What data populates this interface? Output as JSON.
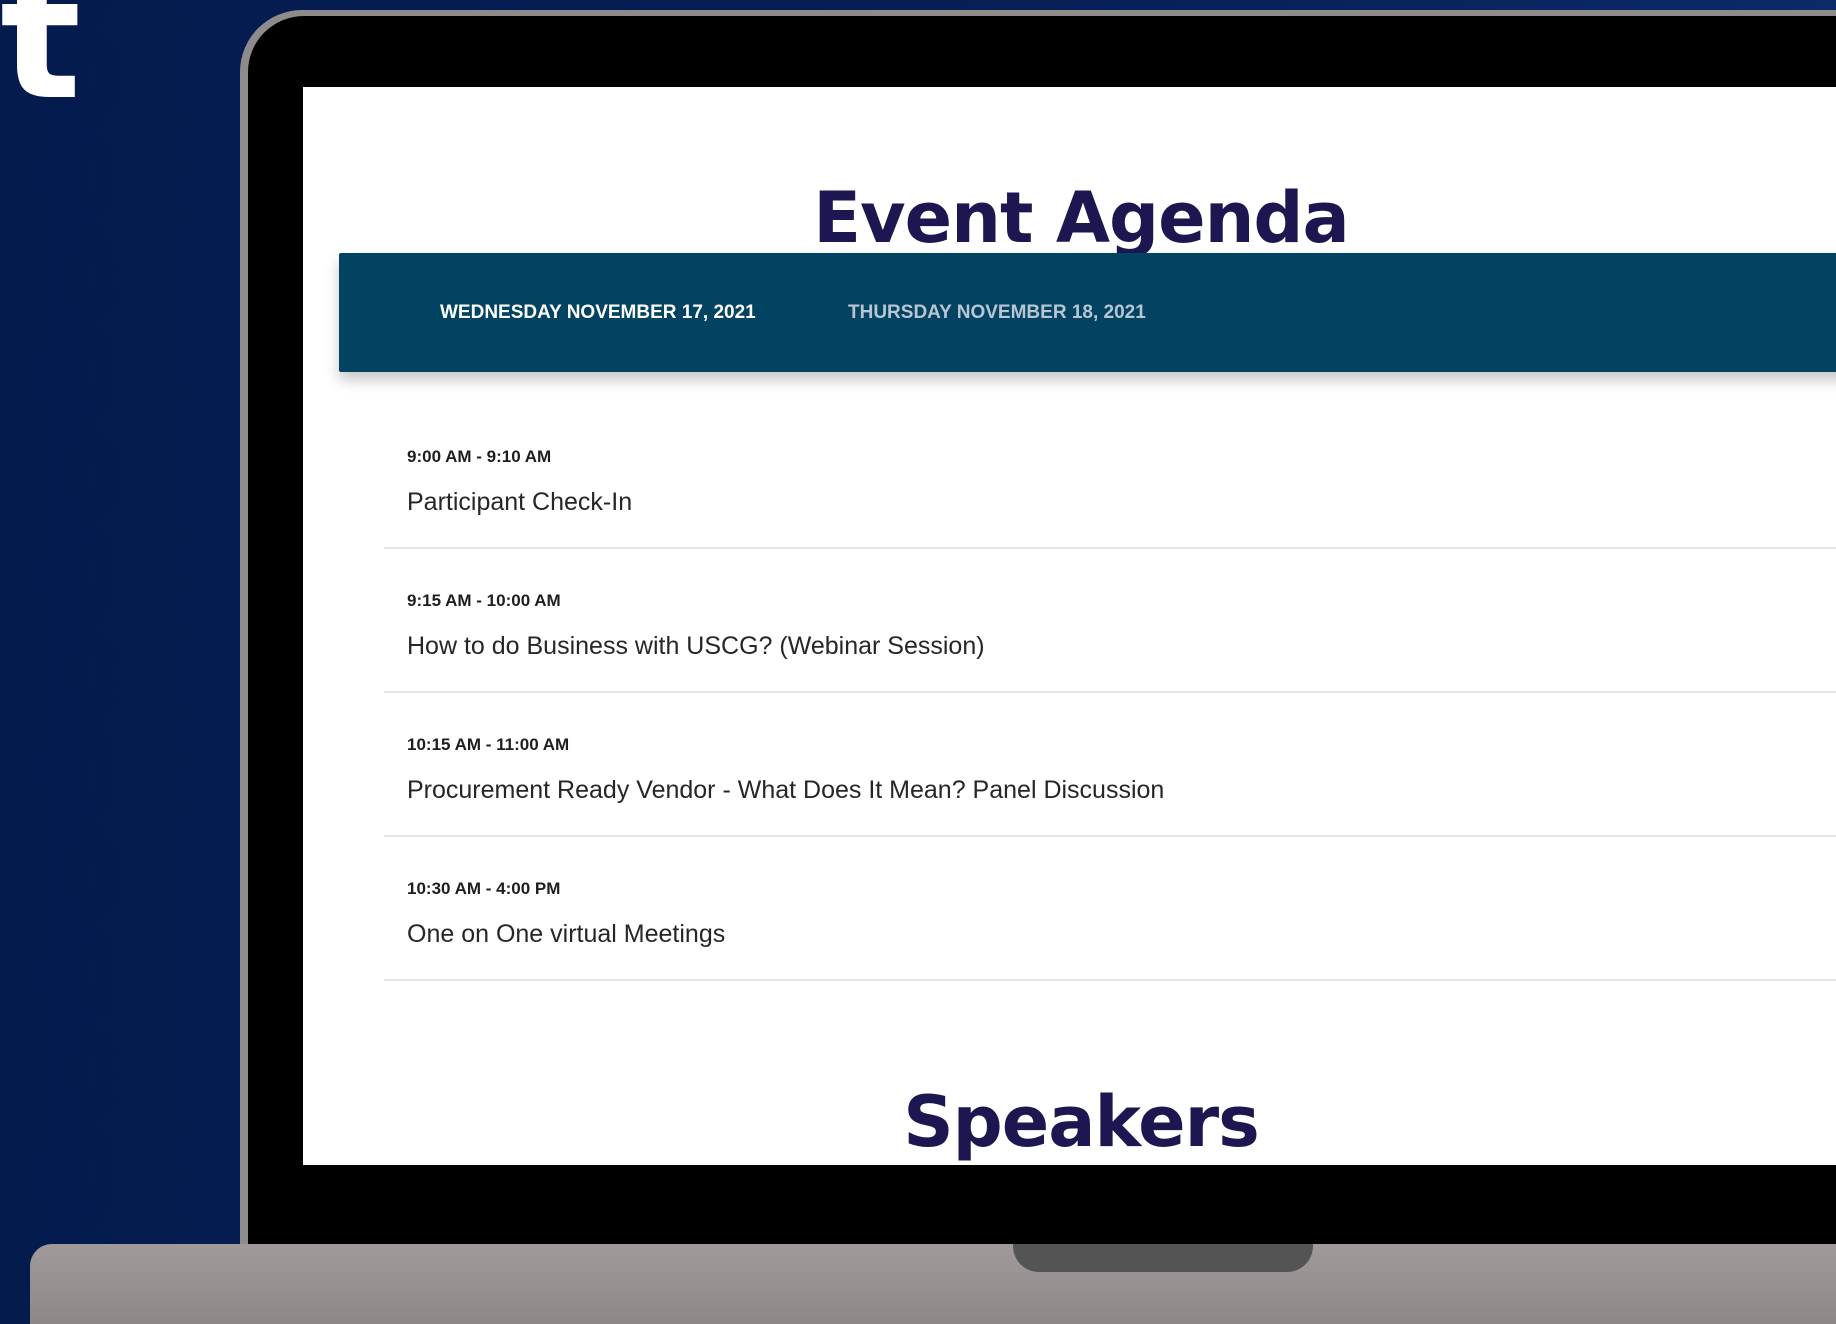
{
  "brand": {
    "corner_letter": "t"
  },
  "page": {
    "title": "Event Agenda",
    "speakers_heading": "Speakers"
  },
  "day_tabs": [
    {
      "label": "WEDNESDAY NOVEMBER 17, 2021",
      "active": true
    },
    {
      "label": "THURSDAY NOVEMBER 18, 2021",
      "active": false
    }
  ],
  "sessions": [
    {
      "time": "9:00 AM - 9:10 AM",
      "name": "Participant Check-In"
    },
    {
      "time": "9:15 AM - 10:00 AM",
      "name": "How to do Business with USCG? (Webinar Session)"
    },
    {
      "time": "10:15 AM - 11:00 AM",
      "name": "Procurement Ready Vendor - What Does It Mean? Panel Discussion"
    },
    {
      "time": "10:30 AM - 4:00 PM",
      "name": "One on One virtual Meetings"
    }
  ],
  "colors": {
    "background": "#062057",
    "title": "#1d1751",
    "day_bar": "#034362",
    "active_tab": "#ffffff",
    "inactive_tab": "#b7c6d2"
  }
}
